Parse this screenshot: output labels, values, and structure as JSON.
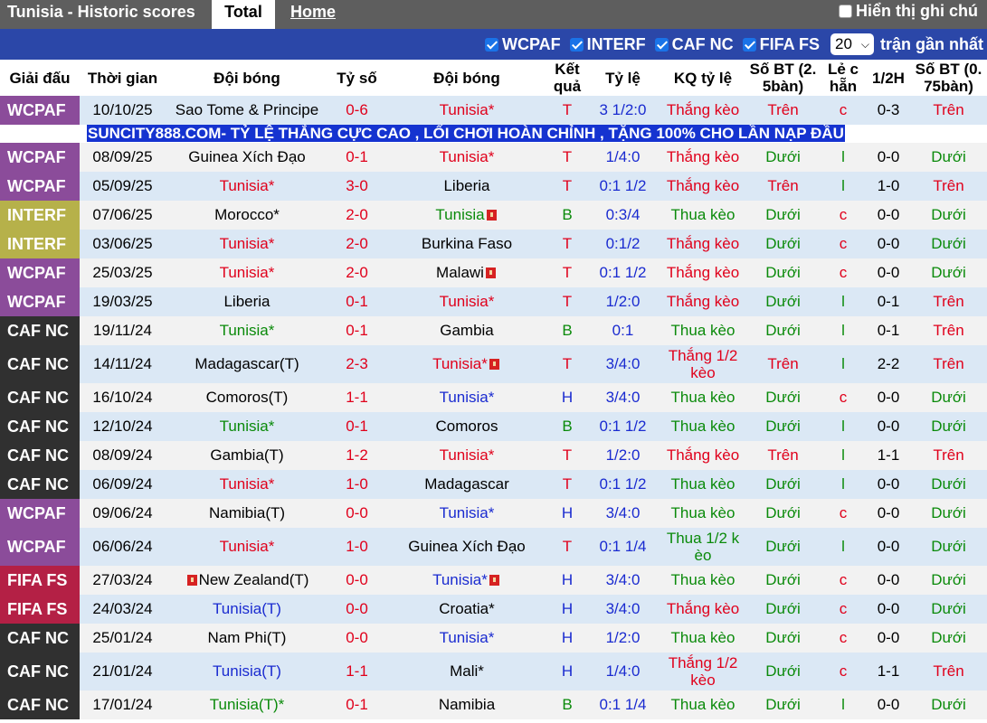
{
  "header": {
    "title": "Tunisia - Historic scores",
    "tab_total": "Total",
    "tab_home": "Home",
    "show_notes": "Hiển thị ghi chú"
  },
  "filters": {
    "items": [
      "WCPAF",
      "INTERF",
      "CAF NC",
      "FIFA FS"
    ],
    "count_value": "20",
    "recent_label": "trận gần nhất"
  },
  "columns": [
    "Giải đấu",
    "Thời gian",
    "Đội bóng",
    "Tỷ số",
    "Đội bóng",
    "Kết quả",
    "Tỷ lệ",
    "KQ tỷ lệ",
    "Số BT (2. 5bàn)",
    "Lẻ c hẵn",
    "1/2H",
    "Số BT (0. 75bàn)"
  ],
  "ad_text": "SUNCITY888.COM- TỶ LỆ THẮNG CỰC CAO , LỐI CHƠI HOÀN CHỈNH , TẶNG 100% CHO LẦN NẠP ĐẦU",
  "colors": {
    "WCPAF": "#8b4c9a",
    "INTERF": "#b6b14a",
    "CAF NC": "#303030",
    "FIFA FS": "#b42045",
    "red": "#e0001b",
    "green": "#0a8a0a",
    "blue": "#1a2bd0"
  },
  "rows": [
    {
      "league": "WCPAF",
      "date": "10/10/25",
      "home": "Sao Tome & Principe",
      "hc": "",
      "score": "0-6",
      "away": "Tunisia*",
      "ac": "red",
      "res": "T",
      "rc": "red",
      "odds": "3 1/2:0",
      "ores": "Thắng kèo",
      "oc": "red",
      "ou": "Trên",
      "uc": "red",
      "oe": "c",
      "ec": "red",
      "half": "0-3",
      "ou2": "Trên",
      "u2c": "red"
    },
    {
      "league": "WCPAF",
      "date": "08/09/25",
      "home": "Guinea Xích Đạo",
      "hc": "",
      "score": "0-1",
      "away": "Tunisia*",
      "ac": "red",
      "res": "T",
      "rc": "red",
      "odds": "1/4:0",
      "ores": "Thắng kèo",
      "oc": "red",
      "ou": "Dưới",
      "uc": "green",
      "oe": "l",
      "ec": "green",
      "half": "0-0",
      "ou2": "Dưới",
      "u2c": "green"
    },
    {
      "league": "WCPAF",
      "date": "05/09/25",
      "home": "Tunisia*",
      "hc": "red",
      "score": "3-0",
      "away": "Liberia",
      "ac": "",
      "res": "T",
      "rc": "red",
      "odds": "0:1 1/2",
      "ores": "Thắng kèo",
      "oc": "red",
      "ou": "Trên",
      "uc": "red",
      "oe": "l",
      "ec": "green",
      "half": "1-0",
      "ou2": "Trên",
      "u2c": "red"
    },
    {
      "league": "INTERF",
      "date": "07/06/25",
      "home": "Morocco*",
      "hc": "",
      "score": "2-0",
      "away": "Tunisia",
      "ac": "green",
      "res": "B",
      "rc": "green",
      "odds": "0:3/4",
      "ores": "Thua kèo",
      "oc": "green",
      "ou": "Dưới",
      "uc": "green",
      "oe": "c",
      "ec": "red",
      "half": "0-0",
      "ou2": "Dưới",
      "u2c": "green",
      "aflag": true
    },
    {
      "league": "INTERF",
      "date": "03/06/25",
      "home": "Tunisia*",
      "hc": "red",
      "score": "2-0",
      "away": "Burkina Faso",
      "ac": "",
      "res": "T",
      "rc": "red",
      "odds": "0:1/2",
      "ores": "Thắng kèo",
      "oc": "red",
      "ou": "Dưới",
      "uc": "green",
      "oe": "c",
      "ec": "red",
      "half": "0-0",
      "ou2": "Dưới",
      "u2c": "green"
    },
    {
      "league": "WCPAF",
      "date": "25/03/25",
      "home": "Tunisia*",
      "hc": "red",
      "score": "2-0",
      "away": "Malawi",
      "ac": "",
      "res": "T",
      "rc": "red",
      "odds": "0:1 1/2",
      "ores": "Thắng kèo",
      "oc": "red",
      "ou": "Dưới",
      "uc": "green",
      "oe": "c",
      "ec": "red",
      "half": "0-0",
      "ou2": "Dưới",
      "u2c": "green",
      "aflag": true
    },
    {
      "league": "WCPAF",
      "date": "19/03/25",
      "home": "Liberia",
      "hc": "",
      "score": "0-1",
      "away": "Tunisia*",
      "ac": "red",
      "res": "T",
      "rc": "red",
      "odds": "1/2:0",
      "ores": "Thắng kèo",
      "oc": "red",
      "ou": "Dưới",
      "uc": "green",
      "oe": "l",
      "ec": "green",
      "half": "0-1",
      "ou2": "Trên",
      "u2c": "red"
    },
    {
      "league": "CAF NC",
      "date": "19/11/24",
      "home": "Tunisia*",
      "hc": "green",
      "score": "0-1",
      "away": "Gambia",
      "ac": "",
      "res": "B",
      "rc": "green",
      "odds": "0:1",
      "ores": "Thua kèo",
      "oc": "green",
      "ou": "Dưới",
      "uc": "green",
      "oe": "l",
      "ec": "green",
      "half": "0-1",
      "ou2": "Trên",
      "u2c": "red"
    },
    {
      "league": "CAF NC",
      "date": "14/11/24",
      "home": "Madagascar(T)",
      "hc": "",
      "score": "2-3",
      "away": "Tunisia*",
      "ac": "red",
      "res": "T",
      "rc": "red",
      "odds": "3/4:0",
      "ores": "Thắng 1/2 kèo",
      "oc": "red",
      "ou": "Trên",
      "uc": "red",
      "oe": "l",
      "ec": "green",
      "half": "2-2",
      "ou2": "Trên",
      "u2c": "red",
      "aflag": true,
      "tall": true
    },
    {
      "league": "CAF NC",
      "date": "16/10/24",
      "home": "Comoros(T)",
      "hc": "",
      "score": "1-1",
      "away": "Tunisia*",
      "ac": "blue",
      "res": "H",
      "rc": "blue",
      "odds": "3/4:0",
      "ores": "Thua kèo",
      "oc": "green",
      "ou": "Dưới",
      "uc": "green",
      "oe": "c",
      "ec": "red",
      "half": "0-0",
      "ou2": "Dưới",
      "u2c": "green"
    },
    {
      "league": "CAF NC",
      "date": "12/10/24",
      "home": "Tunisia*",
      "hc": "green",
      "score": "0-1",
      "away": "Comoros",
      "ac": "",
      "res": "B",
      "rc": "green",
      "odds": "0:1 1/2",
      "ores": "Thua kèo",
      "oc": "green",
      "ou": "Dưới",
      "uc": "green",
      "oe": "l",
      "ec": "green",
      "half": "0-0",
      "ou2": "Dưới",
      "u2c": "green"
    },
    {
      "league": "CAF NC",
      "date": "08/09/24",
      "home": "Gambia(T)",
      "hc": "",
      "score": "1-2",
      "away": "Tunisia*",
      "ac": "red",
      "res": "T",
      "rc": "red",
      "odds": "1/2:0",
      "ores": "Thắng kèo",
      "oc": "red",
      "ou": "Trên",
      "uc": "red",
      "oe": "l",
      "ec": "green",
      "half": "1-1",
      "ou2": "Trên",
      "u2c": "red"
    },
    {
      "league": "CAF NC",
      "date": "06/09/24",
      "home": "Tunisia*",
      "hc": "red",
      "score": "1-0",
      "away": "Madagascar",
      "ac": "",
      "res": "T",
      "rc": "red",
      "odds": "0:1 1/2",
      "ores": "Thua kèo",
      "oc": "green",
      "ou": "Dưới",
      "uc": "green",
      "oe": "l",
      "ec": "green",
      "half": "0-0",
      "ou2": "Dưới",
      "u2c": "green"
    },
    {
      "league": "WCPAF",
      "date": "09/06/24",
      "home": "Namibia(T)",
      "hc": "",
      "score": "0-0",
      "away": "Tunisia*",
      "ac": "blue",
      "res": "H",
      "rc": "blue",
      "odds": "3/4:0",
      "ores": "Thua kèo",
      "oc": "green",
      "ou": "Dưới",
      "uc": "green",
      "oe": "c",
      "ec": "red",
      "half": "0-0",
      "ou2": "Dưới",
      "u2c": "green"
    },
    {
      "league": "WCPAF",
      "date": "06/06/24",
      "home": "Tunisia*",
      "hc": "red",
      "score": "1-0",
      "away": "Guinea Xích Đạo",
      "ac": "",
      "res": "T",
      "rc": "red",
      "odds": "0:1 1/4",
      "ores": "Thua 1/2 k èo",
      "oc": "green",
      "ou": "Dưới",
      "uc": "green",
      "oe": "l",
      "ec": "green",
      "half": "0-0",
      "ou2": "Dưới",
      "u2c": "green",
      "tall": true
    },
    {
      "league": "FIFA FS",
      "date": "27/03/24",
      "home": "New Zealand(T)",
      "hc": "",
      "score": "0-0",
      "away": "Tunisia*",
      "ac": "blue",
      "res": "H",
      "rc": "blue",
      "odds": "3/4:0",
      "ores": "Thua kèo",
      "oc": "green",
      "ou": "Dưới",
      "uc": "green",
      "oe": "c",
      "ec": "red",
      "half": "0-0",
      "ou2": "Dưới",
      "u2c": "green",
      "hflag": true,
      "aflag": true
    },
    {
      "league": "FIFA FS",
      "date": "24/03/24",
      "home": "Tunisia(T)",
      "hc": "blue",
      "score": "0-0",
      "away": "Croatia*",
      "ac": "",
      "res": "H",
      "rc": "blue",
      "odds": "3/4:0",
      "ores": "Thắng kèo",
      "oc": "red",
      "ou": "Dưới",
      "uc": "green",
      "oe": "c",
      "ec": "red",
      "half": "0-0",
      "ou2": "Dưới",
      "u2c": "green"
    },
    {
      "league": "CAF NC",
      "date": "25/01/24",
      "home": "Nam Phi(T)",
      "hc": "",
      "score": "0-0",
      "away": "Tunisia*",
      "ac": "blue",
      "res": "H",
      "rc": "blue",
      "odds": "1/2:0",
      "ores": "Thua kèo",
      "oc": "green",
      "ou": "Dưới",
      "uc": "green",
      "oe": "c",
      "ec": "red",
      "half": "0-0",
      "ou2": "Dưới",
      "u2c": "green"
    },
    {
      "league": "CAF NC",
      "date": "21/01/24",
      "home": "Tunisia(T)",
      "hc": "blue",
      "score": "1-1",
      "away": "Mali*",
      "ac": "",
      "res": "H",
      "rc": "blue",
      "odds": "1/4:0",
      "ores": "Thắng 1/2 kèo",
      "oc": "red",
      "ou": "Dưới",
      "uc": "green",
      "oe": "c",
      "ec": "red",
      "half": "1-1",
      "ou2": "Trên",
      "u2c": "red",
      "tall": true
    },
    {
      "league": "CAF NC",
      "date": "17/01/24",
      "home": "Tunisia(T)*",
      "hc": "green",
      "score": "0-1",
      "away": "Namibia",
      "ac": "",
      "res": "B",
      "rc": "green",
      "odds": "0:1 1/4",
      "ores": "Thua kèo",
      "oc": "green",
      "ou": "Dưới",
      "uc": "green",
      "oe": "l",
      "ec": "green",
      "half": "0-0",
      "ou2": "Dưới",
      "u2c": "green"
    }
  ]
}
